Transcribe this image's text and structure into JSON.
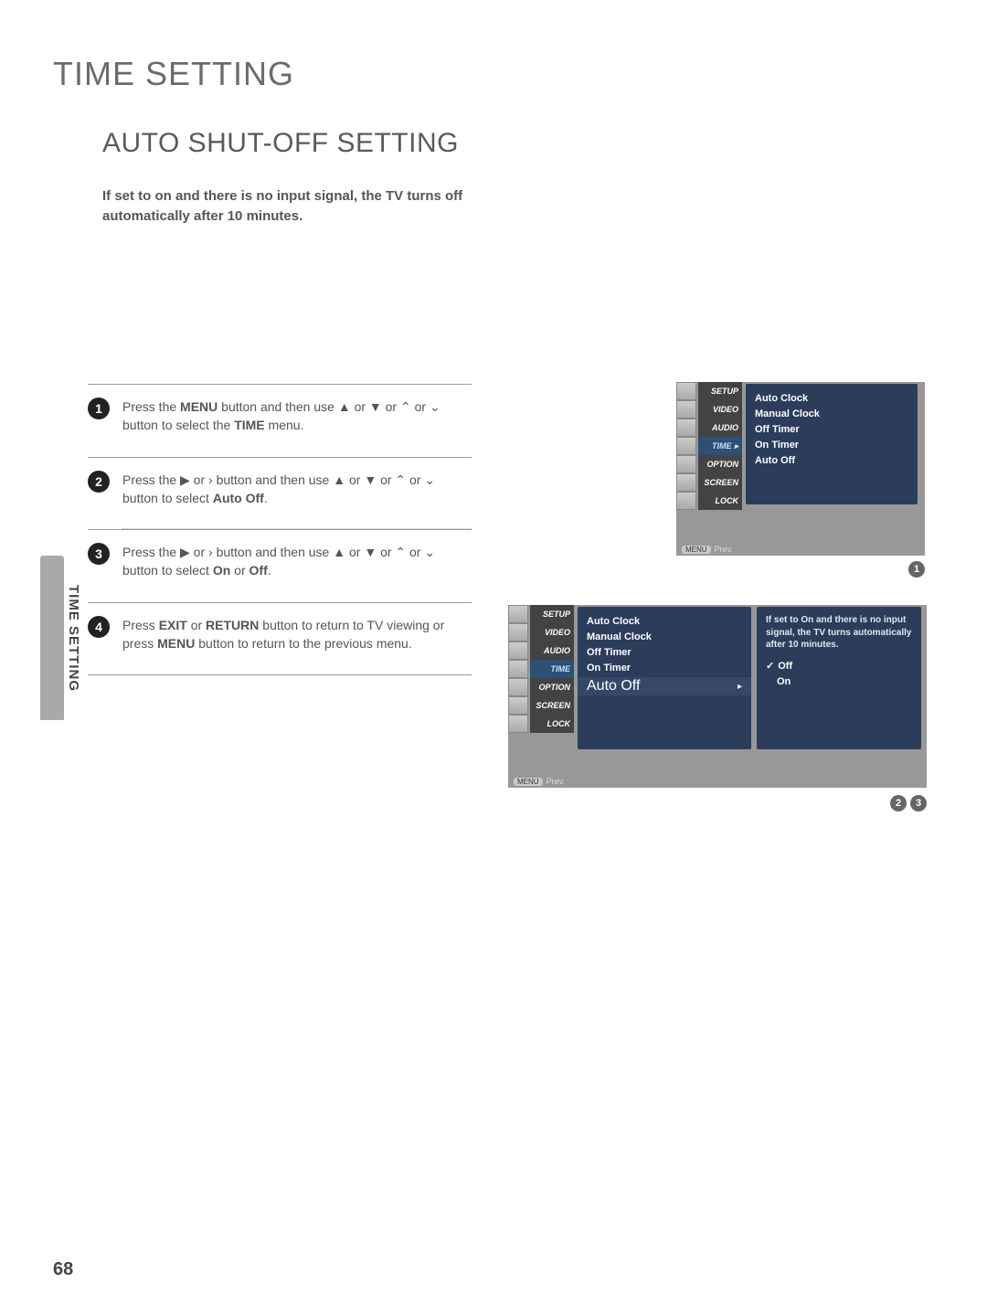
{
  "page": {
    "number": "68",
    "chapter": "TIME SETTING",
    "section": "AUTO SHUT-OFF SETTING",
    "side_tab": "TIME SETTING",
    "intro": "If set to on and there is no input signal, the TV turns off automatically after 10 minutes."
  },
  "steps": [
    {
      "num": "1",
      "text_pre": "Press the ",
      "b1": "MENU",
      "mid1": " button and then use ▲ or ▼ or  ⌃ or  ⌄  button to select the ",
      "b2": "TIME",
      "mid2": " menu."
    },
    {
      "num": "2",
      "text_pre": "Press the ▶ or  ›  button and then use ▲ or ▼ or  ⌃  or  ⌄  button to select ",
      "b1": "Auto Off",
      "mid1": ".",
      "b2": "",
      "mid2": ""
    },
    {
      "num": "3",
      "text_pre": "Press the ▶ or  ›  button and then use ▲ or ▼ or  ⌃  or  ⌄  button to select ",
      "b1": "On",
      "mid1": " or ",
      "b2": "Off",
      "mid2": "."
    },
    {
      "num": "4",
      "text_pre": "Press ",
      "b1": "EXIT",
      "mid1": " or ",
      "b2": "RETURN",
      "mid2": " button to return to TV viewing or press ",
      "b3": "MENU",
      "mid3": " button to return to the previous menu."
    }
  ],
  "osd_nav": [
    "SETUP",
    "VIDEO",
    "AUDIO",
    "TIME",
    "OPTION",
    "SCREEN",
    "LOCK"
  ],
  "osd1_panel": [
    "Auto Clock",
    "Manual Clock",
    "Off Timer",
    "On Timer",
    "Auto Off"
  ],
  "osd2_panelA": {
    "rows": [
      "Auto Clock",
      "Manual Clock",
      "Off Timer",
      "On Timer"
    ],
    "selected": "Auto Off"
  },
  "osd2_panelB": {
    "hint": "If set to On and there is no input signal, the TV turns automatically after 10 minutes.",
    "options": [
      "Off",
      "On"
    ],
    "checked": "Off"
  },
  "osd_footer": {
    "badge": "MENU",
    "text": "Prev."
  },
  "refs": {
    "r1": "1",
    "r2a": "2",
    "r2b": "3"
  }
}
